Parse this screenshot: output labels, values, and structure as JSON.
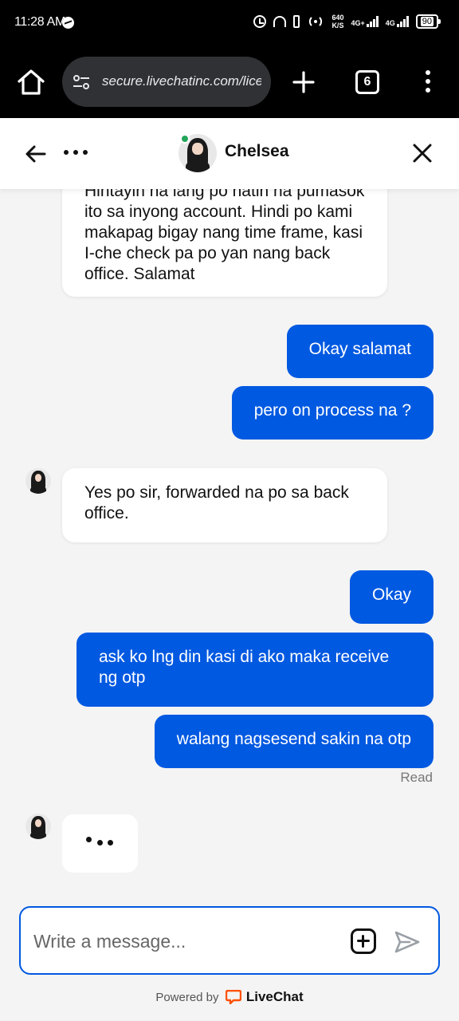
{
  "status_bar": {
    "time": "11:28 AM",
    "net_speed_value": "640",
    "net_speed_unit": "K/S",
    "network_1": "4G+",
    "network_2": "4G",
    "battery": "90"
  },
  "browser": {
    "url": "secure.livechatinc.com/lice",
    "tab_count": "6"
  },
  "chat": {
    "agent_name": "Chelsea",
    "online_color": "#23a55a",
    "messages": [
      {
        "from": "agent",
        "text": "Hintayin na lang po natin na pumasok ito sa inyong account. Hindi po kami makapag bigay nang time frame, kasi I-che check pa po yan nang back office. Salamat"
      },
      {
        "from": "user",
        "text": "Okay salamat"
      },
      {
        "from": "user",
        "text": "pero on process na ?"
      },
      {
        "from": "agent",
        "text": "Yes po sir, forwarded na po sa back office."
      },
      {
        "from": "user",
        "text": "Okay"
      },
      {
        "from": "user",
        "text": "ask ko lng din kasi di ako maka receive ng otp"
      },
      {
        "from": "user",
        "text": "walang nagsesend sakin na otp"
      }
    ],
    "read_status": "Read"
  },
  "composer": {
    "placeholder": "Write a message..."
  },
  "footer": {
    "powered_by": "Powered by",
    "brand": "LiveChat"
  },
  "colors": {
    "accent": "#0059e1",
    "brand_orange": "#ff5100"
  }
}
